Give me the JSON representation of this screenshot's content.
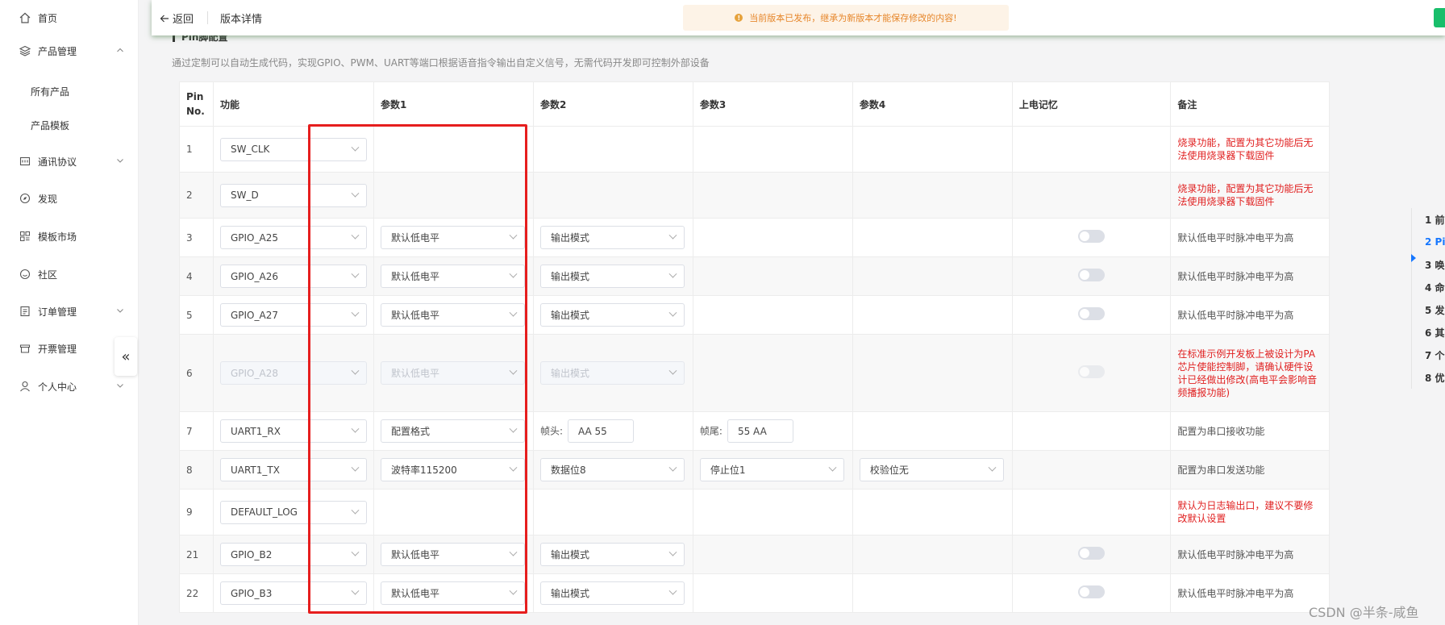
{
  "sidebar": {
    "items": [
      {
        "label": "首页",
        "icon": "home-icon"
      },
      {
        "label": "产品管理",
        "icon": "layers-icon",
        "expanded": true
      },
      {
        "label": "所有产品",
        "sub": true
      },
      {
        "label": "产品模板",
        "sub": true
      },
      {
        "label": "通讯协议",
        "icon": "protocol-icon"
      },
      {
        "label": "发现",
        "icon": "compass-icon"
      },
      {
        "label": "模板市场",
        "icon": "market-icon"
      },
      {
        "label": "社区",
        "icon": "community-icon"
      },
      {
        "label": "订单管理",
        "icon": "order-icon"
      },
      {
        "label": "开票管理",
        "icon": "invoice-icon"
      },
      {
        "label": "个人中心",
        "icon": "user-icon"
      }
    ],
    "collapse_glyph": "«"
  },
  "topbar": {
    "back_label": "返回",
    "title": "版本详情",
    "notice": "当前版本已发布，继承为新版本才能保存修改的内容!"
  },
  "section": {
    "title": "Pin脚配置",
    "description": "通过定制可以自动生成代码，实现GPIO、PWM、UART等端口根据语音指令输出自定义信号，无需代码开发即可控制外部设备"
  },
  "table": {
    "headers": [
      "Pin No.",
      "功能",
      "参数1",
      "参数2",
      "参数3",
      "参数4",
      "上电记忆",
      "备注"
    ],
    "rows": [
      {
        "pin": "1",
        "func": "SW_CLK",
        "note": "烧录功能，配置为其它功能后无法使用烧录器下载固件",
        "note_red": true
      },
      {
        "pin": "2",
        "func": "SW_D",
        "note": "烧录功能，配置为其它功能后无法使用烧录器下载固件",
        "note_red": true
      },
      {
        "pin": "3",
        "func": "GPIO_A25",
        "p1": "默认低电平",
        "p2": "输出模式",
        "toggle": true,
        "note": "默认低电平时脉冲电平为高"
      },
      {
        "pin": "4",
        "func": "GPIO_A26",
        "p1": "默认低电平",
        "p2": "输出模式",
        "toggle": true,
        "note": "默认低电平时脉冲电平为高"
      },
      {
        "pin": "5",
        "func": "GPIO_A27",
        "p1": "默认低电平",
        "p2": "输出模式",
        "toggle": true,
        "note": "默认低电平时脉冲电平为高"
      },
      {
        "pin": "6",
        "func": "GPIO_A28",
        "p1": "默认低电平",
        "p2": "输出模式",
        "toggle": true,
        "disabled": true,
        "note": "在标准示例开发板上被设计为PA芯片使能控制脚，请确认硬件设计已经做出修改(高电平会影响音频播报功能)",
        "note_red": true
      },
      {
        "pin": "7",
        "func": "UART1_RX",
        "p1": "配置格式",
        "p2_label": "帧头:",
        "p2_input": "AA 55",
        "p3_label": "帧尾:",
        "p3_input": "55 AA",
        "note": "配置为串口接收功能"
      },
      {
        "pin": "8",
        "func": "UART1_TX",
        "p1": "波特率115200",
        "p2": "数据位8",
        "p3": "停止位1",
        "p4": "校验位无",
        "note": "配置为串口发送功能"
      },
      {
        "pin": "9",
        "func": "DEFAULT_LOG",
        "note": "默认为日志输出口，建议不要修改默认设置",
        "note_red": true
      },
      {
        "pin": "21",
        "func": "GPIO_B2",
        "p1": "默认低电平",
        "p2": "输出模式",
        "toggle": true,
        "note": "默认低电平时脉冲电平为高"
      },
      {
        "pin": "22",
        "func": "GPIO_B3",
        "p1": "默认低电平",
        "p2": "输出模式",
        "toggle": true,
        "note": "默认低电平时脉冲电平为高"
      }
    ]
  },
  "toc": {
    "items": [
      "1 前",
      "2 Pi",
      "3 唤",
      "4 命",
      "5 发",
      "6 其",
      "7 个",
      "8 优"
    ],
    "active_index": 1
  },
  "watermark": "CSDN @半条-咸鱼",
  "colors": {
    "accent": "#1677ff",
    "highlight": "#e61e1e",
    "warning": "#e6a23c",
    "green": "#19be6b",
    "note_red": "#e02020"
  }
}
